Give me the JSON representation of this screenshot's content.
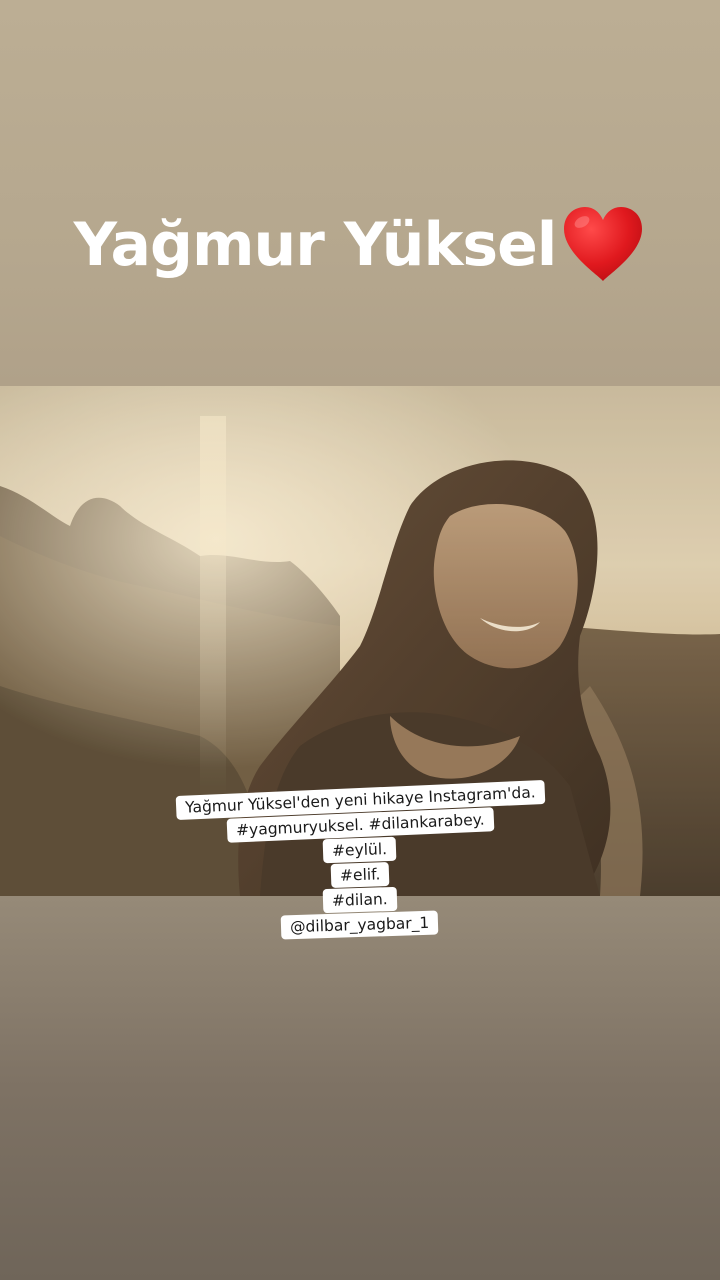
{
  "story": {
    "title": "Yağmur Yüksel",
    "title_icon": "red-heart-icon",
    "colors": {
      "title_text": "#ffffff",
      "heart": "#e0191e",
      "caption_bg": "#ffffff",
      "caption_text": "#1a1a1a"
    }
  },
  "caption": {
    "lines": [
      "Yağmur Yüksel'den yeni hikaye Instagram'da.",
      "#yagmuryuksel. #dilankarabey.",
      "#eylül.",
      "#elif.",
      "#dilan.",
      "@dilbar_yagbar_1"
    ]
  }
}
